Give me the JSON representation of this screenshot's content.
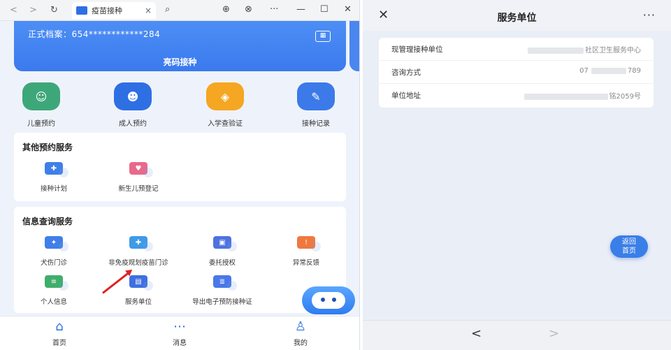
{
  "browser": {
    "tab_title": "疫苗接种",
    "tab_close": "×",
    "back": "<",
    "forward": ">",
    "reload": "↻",
    "search_icon": "⌕",
    "download": "⊕",
    "globe": "⊗",
    "more": "···",
    "minimize": "—",
    "maximize": "☐",
    "close": "✕"
  },
  "banner": {
    "archive_label": "正式档案：654************284",
    "show_code": "亮码接种",
    "qr_icon": "qr-code-icon"
  },
  "quick_actions": [
    {
      "label": "儿童预约",
      "color": "#3ea77a",
      "icon": "child-icon"
    },
    {
      "label": "成人预约",
      "color": "#2f6fe4",
      "icon": "adult-icon"
    },
    {
      "label": "入学查验证",
      "color": "#f5a623",
      "icon": "shield-icon"
    },
    {
      "label": "接种记录",
      "color": "#3b7ae8",
      "icon": "syringe-icon"
    }
  ],
  "other_services": {
    "title": "其他预约服务",
    "items": [
      {
        "label": "接种计划",
        "color": "#3f7fe8"
      },
      {
        "label": "新生儿预登记",
        "color": "#e86a8a"
      }
    ]
  },
  "info_services": {
    "title": "信息查询服务",
    "items": [
      {
        "label": "犬伤门诊",
        "color": "#3f7fe8"
      },
      {
        "label": "非免疫规划疫苗门诊",
        "color": "#3f9ae8"
      },
      {
        "label": "委托授权",
        "color": "#4f72e0"
      },
      {
        "label": "异常反馈",
        "color": "#f07840"
      },
      {
        "label": "个人信息",
        "color": "#3fae6a"
      },
      {
        "label": "服务单位",
        "color": "#3f6fe0"
      },
      {
        "label": "导出电子预防接种证",
        "color": "#4a78e8"
      }
    ]
  },
  "tabbar": [
    {
      "label": "首页",
      "icon": "home-icon",
      "glyph": "⌂"
    },
    {
      "label": "消息",
      "icon": "message-icon",
      "glyph": "⋯"
    },
    {
      "label": "我的",
      "icon": "user-icon",
      "glyph": "♙"
    }
  ],
  "detail": {
    "title": "服务单位",
    "close": "✕",
    "more": "···",
    "rows": [
      {
        "key": "现管理接种单位",
        "value": "社区卫生服务中心"
      },
      {
        "key": "咨询方式",
        "value_prefix": "07",
        "value": "789"
      },
      {
        "key": "单位地址",
        "value": "铭2059号"
      }
    ],
    "home_button": {
      "line1": "返回",
      "line2": "首页"
    },
    "prev": "<",
    "next": ">"
  }
}
